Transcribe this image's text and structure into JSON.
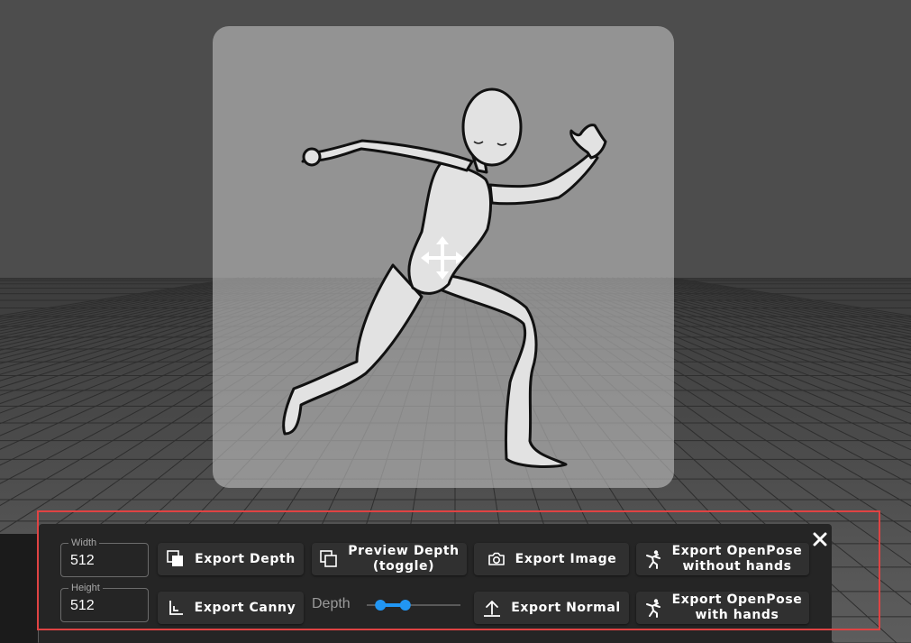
{
  "panel": {
    "width": {
      "label": "Width",
      "value": "512"
    },
    "height": {
      "label": "Height",
      "value": "512"
    },
    "depth_slider": {
      "label": "Depth",
      "range": [
        0.1,
        0.4
      ]
    },
    "buttons": {
      "export_depth": {
        "label": "Export Depth",
        "icon": "layers-icon"
      },
      "preview_depth": {
        "label_line1": "Preview Depth",
        "label_line2": "(toggle)",
        "icon": "layers-icon"
      },
      "export_image": {
        "label": "Export Image",
        "icon": "camera-icon"
      },
      "export_openpose_no_hands": {
        "label_line1": "Export OpenPose",
        "label_line2": "without hands",
        "icon": "pose-icon"
      },
      "export_canny": {
        "label": "Export Canny",
        "icon": "canny-icon"
      },
      "export_normal": {
        "label": "Export Normal",
        "icon": "upload-icon"
      },
      "export_openpose_hands": {
        "label_line1": "Export OpenPose",
        "label_line2": "with hands",
        "icon": "pose-icon"
      }
    },
    "close_icon": "close-icon"
  },
  "colors": {
    "background": "#4a4a4a",
    "floor": "#5a5a5a",
    "panel": "#252525",
    "button": "#303030",
    "accent": "#2196f3",
    "highlight": "#e04343"
  }
}
